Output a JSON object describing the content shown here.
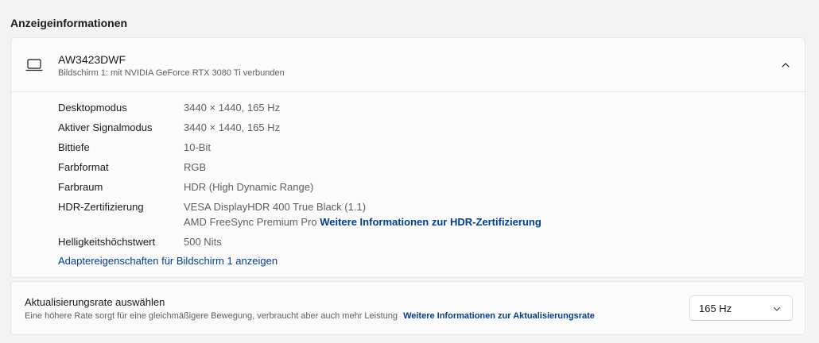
{
  "section": {
    "title": "Anzeigeinformationen"
  },
  "display": {
    "name": "AW3423DWF",
    "subtitle": "Bildschirm 1: mit NVIDIA GeForce RTX 3080 Ti verbunden",
    "expanded_icon": "chevron-up-icon",
    "device_icon": "laptop-icon",
    "details": [
      {
        "label": "Desktopmodus",
        "value": "3440 × 1440, 165 Hz"
      },
      {
        "label": "Aktiver Signalmodus",
        "value": "3440 × 1440, 165 Hz"
      },
      {
        "label": "Bittiefe",
        "value": "10-Bit"
      },
      {
        "label": "Farbformat",
        "value": "RGB"
      },
      {
        "label": "Farbraum",
        "value": "HDR (High Dynamic Range)"
      },
      {
        "label": "HDR-Zertifizierung",
        "value": "VESA DisplayHDR 400 True Black (1.1)",
        "value2": "AMD FreeSync Premium Pro",
        "link": "Weitere Informationen zur HDR-Zertifizierung"
      },
      {
        "label": "Helligkeitshöchstwert",
        "value": "500 Nits"
      }
    ],
    "adapter_link": "Adaptereigenschaften für Bildschirm 1 anzeigen"
  },
  "refresh": {
    "title": "Aktualisierungsrate auswählen",
    "description": "Eine höhere Rate sorgt für eine gleichmäßigere Bewegung, verbraucht aber auch mehr Leistung",
    "link": "Weitere Informationen zur Aktualisierungsrate",
    "selected": "165 Hz"
  },
  "colors": {
    "link": "#003e92",
    "background": "#f3f3f3",
    "card": "#fbfbfb"
  }
}
